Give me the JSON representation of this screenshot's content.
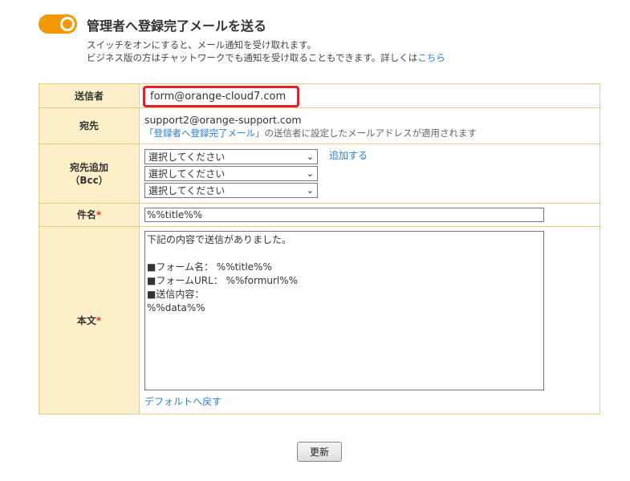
{
  "header": {
    "title": "管理者へ登録完了メールを送る",
    "desc_line1": "スイッチをオンにすると、メール通知を受け取れます。",
    "desc_line2": "ビジネス版の方はチャットワークでも通知を受け取ることもできます。詳しくは",
    "desc_link": "こちら",
    "toggle_on": true,
    "accent": "#f39800"
  },
  "form": {
    "sender": {
      "label": "送信者",
      "value": "form@orange-cloud7.com"
    },
    "to": {
      "label": "宛先",
      "value": "support2@orange-support.com",
      "note_link": "「登録者へ登録完了メール」",
      "note_text": "の送信者に設定したメールアドレスが適用されます"
    },
    "bcc": {
      "label_line1": "宛先追加",
      "label_line2": "（Bcc）",
      "selects": [
        "選択してください",
        "選択してください",
        "選択してください"
      ],
      "add_link": "追加する"
    },
    "subject": {
      "label": "件名",
      "required_mark": "*",
      "value": "%%title%%"
    },
    "body": {
      "label": "本文",
      "required_mark": "*",
      "value": "下記の内容で送信がありました。\n\n■フォーム名： %%title%%\n■フォームURL： %%formurl%%\n■送信内容：\n%%data%%",
      "default_link": "デフォルトへ戻す"
    }
  },
  "actions": {
    "update_label": "更新"
  }
}
